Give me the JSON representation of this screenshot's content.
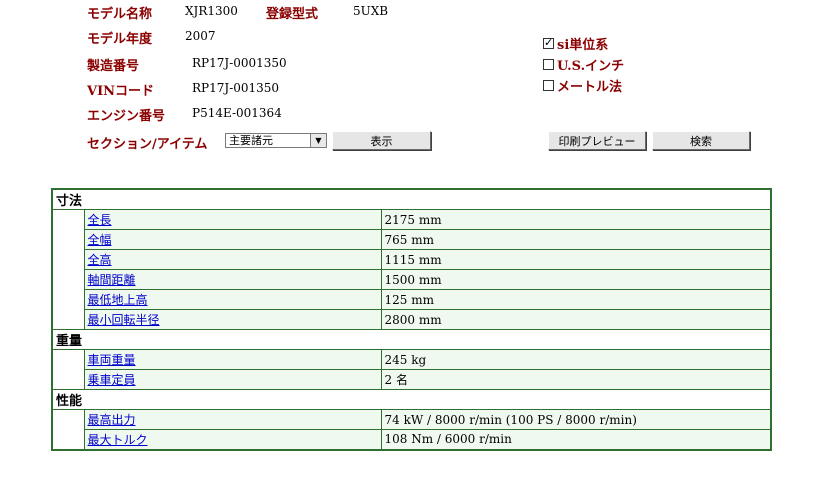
{
  "model": {
    "name_label": "モデル名称",
    "name_value": "XJR1300",
    "reg_label": "登録型式",
    "reg_value": "5UXB",
    "year_label": "モデル年度",
    "year_value": "2007",
    "serial_label": "製造番号",
    "serial_value": "RP17J-0001350",
    "vin_label": "VINコード",
    "vin_value": "RP17J-001350",
    "engine_label": "エンジン番号",
    "engine_value": "P514E-001364",
    "section_label": "セクション/アイテム"
  },
  "units": [
    {
      "label": "si単位系",
      "checked": true
    },
    {
      "label": "U.S.インチ",
      "checked": false
    },
    {
      "label": "メートル法",
      "checked": false
    }
  ],
  "controls": {
    "section_select_value": "主要諸元",
    "show_button": "表示",
    "print_preview_button": "印刷プレビュー",
    "search_button": "検索"
  },
  "specs": {
    "dimensions": {
      "title": "寸法",
      "rows": [
        {
          "name": "全長",
          "value": "2175 mm"
        },
        {
          "name": "全幅",
          "value": "765 mm"
        },
        {
          "name": "全高",
          "value": "1115 mm"
        },
        {
          "name": "軸間距離",
          "value": "1500 mm"
        },
        {
          "name": "最低地上高",
          "value": "125 mm"
        },
        {
          "name": "最小回転半径",
          "value": "2800 mm"
        }
      ]
    },
    "weight": {
      "title": "重量",
      "rows": [
        {
          "name": "車両重量",
          "value": "245 kg"
        },
        {
          "name": "乗車定員",
          "value": "2 名"
        }
      ]
    },
    "performance": {
      "title": "性能",
      "rows": [
        {
          "name": "最高出力",
          "value": "74 kW / 8000 r/min (100 PS / 8000 r/min)"
        },
        {
          "name": "最大トルク",
          "value": "108 Nm / 6000 r/min"
        }
      ]
    }
  },
  "colors": {
    "label_red": "#8b0000",
    "table_border": "#2f6f2f",
    "row_bg": "#f0f9f0",
    "link_blue": "#0000cc"
  }
}
